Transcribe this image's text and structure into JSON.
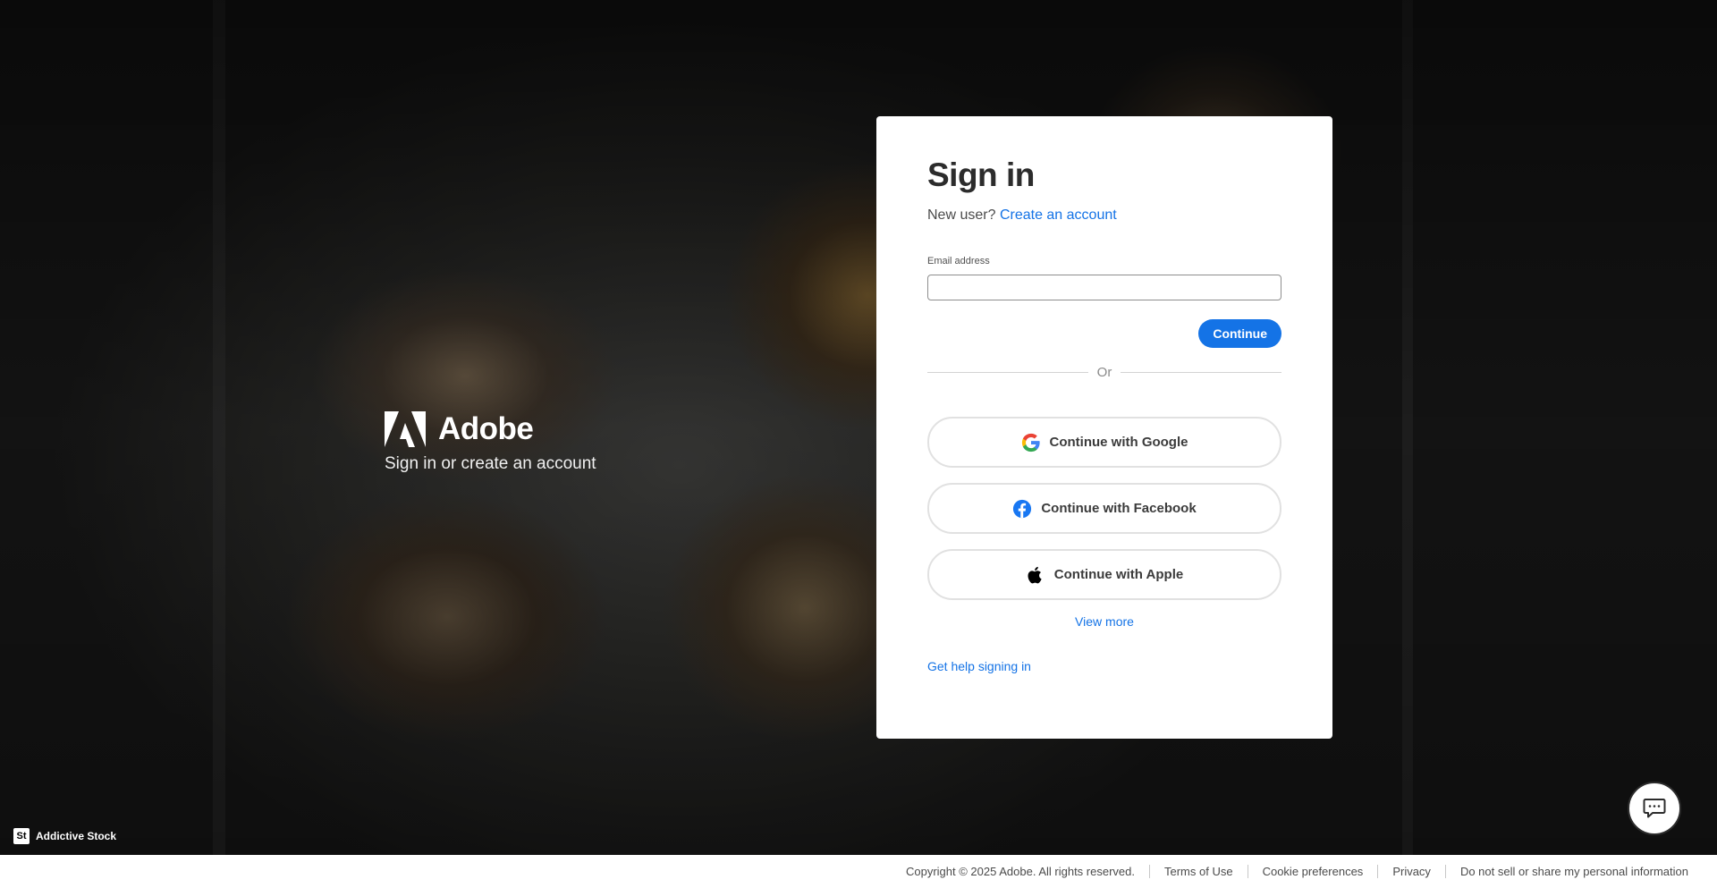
{
  "brand": {
    "name": "Adobe",
    "tagline": "Sign in or create an account"
  },
  "signin": {
    "title": "Sign in",
    "new_user_prompt": "New user?",
    "create_account_link": "Create an account",
    "email_label": "Email address",
    "email_value": "",
    "continue_label": "Continue",
    "divider_text": "Or"
  },
  "social": {
    "google_label": "Continue with Google",
    "facebook_label": "Continue with Facebook",
    "apple_label": "Continue with Apple"
  },
  "links": {
    "view_more": "View more",
    "help": "Get help signing in"
  },
  "credit": {
    "badge": "St",
    "name": "Addictive Stock"
  },
  "footer": {
    "copyright": "Copyright © 2025 Adobe. All rights reserved.",
    "terms": "Terms of Use",
    "cookies": "Cookie preferences",
    "privacy": "Privacy",
    "do_not_sell": "Do not sell or share my personal information"
  },
  "colors": {
    "accent": "#1473e6",
    "facebook": "#1877f2"
  },
  "icons": {
    "brand": "adobe-logo",
    "google": "google-icon",
    "facebook": "facebook-icon",
    "apple": "apple-icon",
    "chat": "chat-icon"
  }
}
